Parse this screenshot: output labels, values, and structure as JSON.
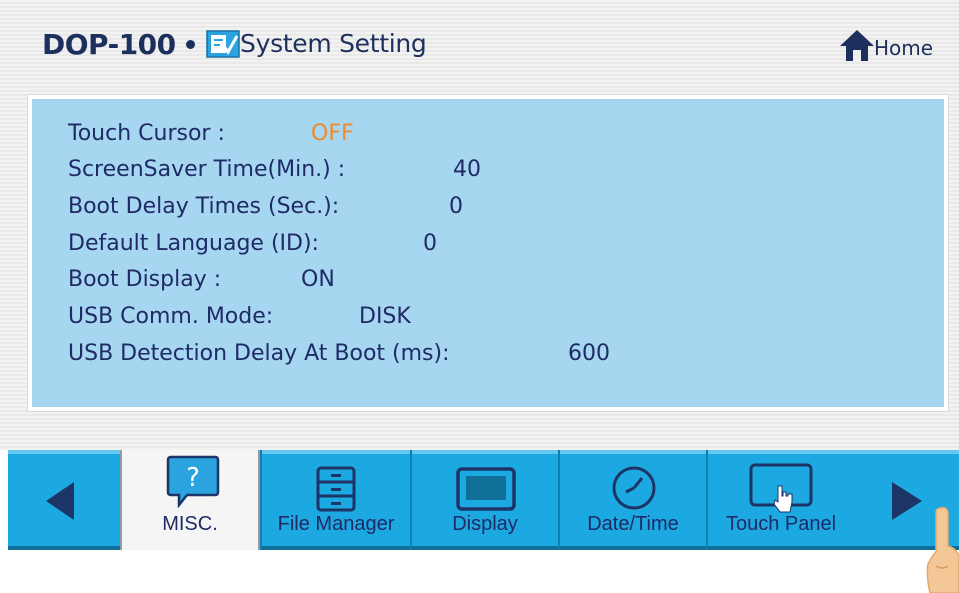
{
  "header": {
    "brand": "DOP-100",
    "title": "System Setting",
    "home_label": "Home",
    "title_icon": "settings-checklist-icon",
    "home_icon": "home-icon"
  },
  "settings": [
    {
      "label": "Touch Cursor :",
      "value": "OFF"
    },
    {
      "label": "ScreenSaver Time(Min.) :",
      "value": "40"
    },
    {
      "label": "Boot Delay Times (Sec.):",
      "value": "0"
    },
    {
      "label": "Default Language (ID):",
      "value": "0"
    },
    {
      "label": "Boot Display :",
      "value": "ON"
    },
    {
      "label": "USB Comm. Mode:",
      "value": "DISK"
    },
    {
      "label": "USB Detection Delay At Boot (ms):",
      "value": "600"
    }
  ],
  "tabs": [
    {
      "label": "MISC.",
      "icon": "question-icon",
      "active": true
    },
    {
      "label": "File Manager",
      "icon": "file-cabinet-icon",
      "active": false
    },
    {
      "label": "Display",
      "icon": "monitor-icon",
      "active": false
    },
    {
      "label": "Date/Time",
      "icon": "clock-icon",
      "active": false
    },
    {
      "label": "Touch Panel",
      "icon": "touch-panel-icon",
      "active": false
    }
  ],
  "colors": {
    "panel": "#a6d6f0",
    "tabbar": "#1ca8e0",
    "text": "#1f2a66",
    "off_value": "#ee8a2a"
  }
}
